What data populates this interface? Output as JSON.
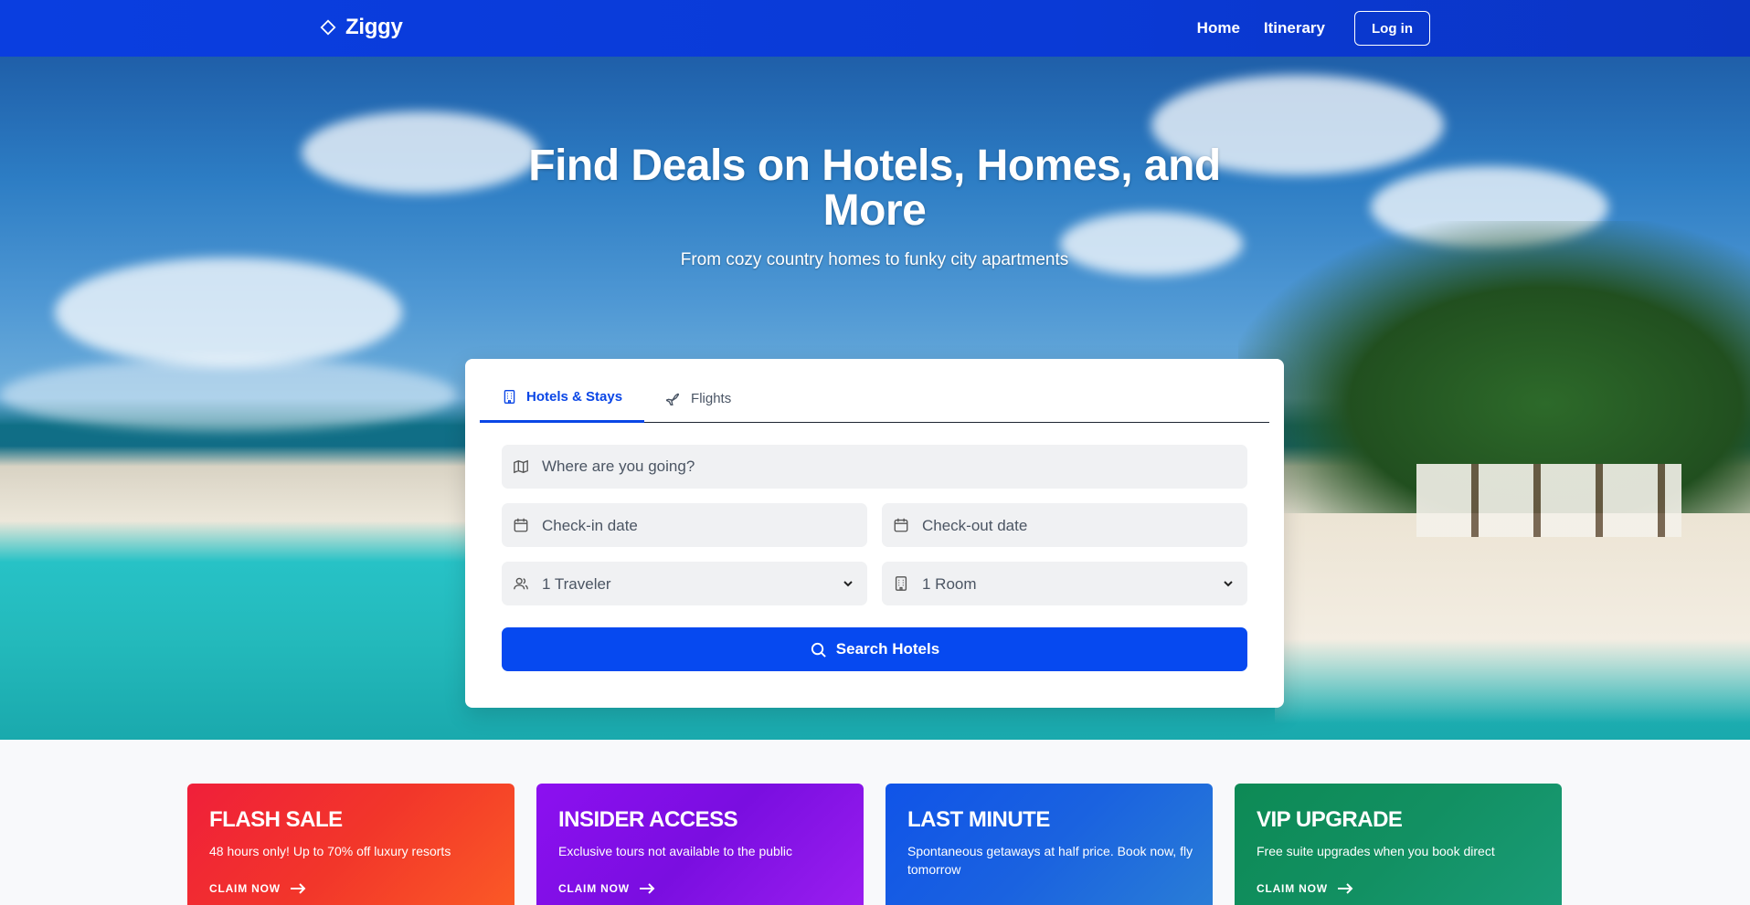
{
  "brand": {
    "name": "Ziggy",
    "icon": "diamond-icon"
  },
  "nav": {
    "home": "Home",
    "itinerary": "Itinerary",
    "login": "Log in"
  },
  "hero": {
    "title": "Find Deals on Hotels, Homes, and More",
    "subtitle": "From cozy country homes to funky city apartments"
  },
  "search": {
    "tabs": [
      {
        "label": "Hotels & Stays",
        "icon": "building-icon",
        "active": true
      },
      {
        "label": "Flights",
        "icon": "plane-icon",
        "active": false
      }
    ],
    "destination_placeholder": "Where are you going?",
    "checkin_placeholder": "Check-in date",
    "checkout_placeholder": "Check-out date",
    "travelers_value": "1 Traveler",
    "rooms_value": "1 Room",
    "button_label": "Search Hotels"
  },
  "promos": [
    {
      "title": "FLASH SALE",
      "desc": "48 hours only! Up to 70% off luxury resorts",
      "cta": "CLAIM NOW",
      "color": "#f0242f"
    },
    {
      "title": "INSIDER ACCESS",
      "desc": "Exclusive tours not available to the public",
      "cta": "CLAIM NOW",
      "color": "#8a10ea"
    },
    {
      "title": "LAST MINUTE",
      "desc": "Spontaneous getaways at half price. Book now, fly tomorrow",
      "cta": "",
      "color": "#1257e6"
    },
    {
      "title": "VIP UPGRADE",
      "desc": "Free suite upgrades when you book direct",
      "cta": "CLAIM NOW",
      "color": "#0f8a5a"
    }
  ],
  "colors": {
    "primary": "#0649f0",
    "nav": "#0a3ee0"
  }
}
